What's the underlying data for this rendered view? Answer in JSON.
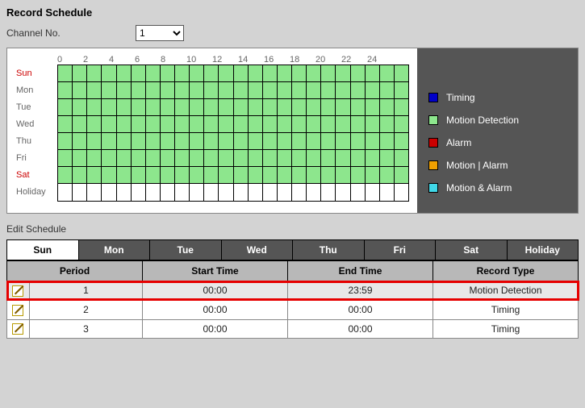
{
  "header": {
    "title": "Record Schedule"
  },
  "channel": {
    "label": "Channel No.",
    "selected": "1",
    "options": [
      "1"
    ]
  },
  "hours": [
    "0",
    "2",
    "4",
    "6",
    "8",
    "10",
    "12",
    "14",
    "16",
    "18",
    "20",
    "22",
    "24"
  ],
  "days": [
    {
      "label": "Sun",
      "weekend": true,
      "fill": "motion"
    },
    {
      "label": "Mon",
      "weekend": false,
      "fill": "motion"
    },
    {
      "label": "Tue",
      "weekend": false,
      "fill": "motion"
    },
    {
      "label": "Wed",
      "weekend": false,
      "fill": "motion"
    },
    {
      "label": "Thu",
      "weekend": false,
      "fill": "motion"
    },
    {
      "label": "Fri",
      "weekend": false,
      "fill": "motion"
    },
    {
      "label": "Sat",
      "weekend": true,
      "fill": "motion"
    },
    {
      "label": "Holiday",
      "weekend": false,
      "fill": "none"
    }
  ],
  "legend": [
    {
      "label": "Timing",
      "color": "#0000c8"
    },
    {
      "label": "Motion Detection",
      "color": "#8de68d"
    },
    {
      "label": "Alarm",
      "color": "#cc0000"
    },
    {
      "label": "Motion | Alarm",
      "color": "#f0a000"
    },
    {
      "label": "Motion & Alarm",
      "color": "#40d8e8"
    }
  ],
  "edit": {
    "title": "Edit Schedule",
    "tabs": [
      "Sun",
      "Mon",
      "Tue",
      "Wed",
      "Thu",
      "Fri",
      "Sat",
      "Holiday"
    ],
    "active_tab": "Sun",
    "columns": {
      "period": "Period",
      "start": "Start Time",
      "end": "End Time",
      "type": "Record Type"
    },
    "rows": [
      {
        "period": "1",
        "start": "00:00",
        "end": "23:59",
        "type": "Motion Detection",
        "highlight": true
      },
      {
        "period": "2",
        "start": "00:00",
        "end": "00:00",
        "type": "Timing",
        "highlight": false
      },
      {
        "period": "3",
        "start": "00:00",
        "end": "00:00",
        "type": "Timing",
        "highlight": false
      }
    ]
  }
}
